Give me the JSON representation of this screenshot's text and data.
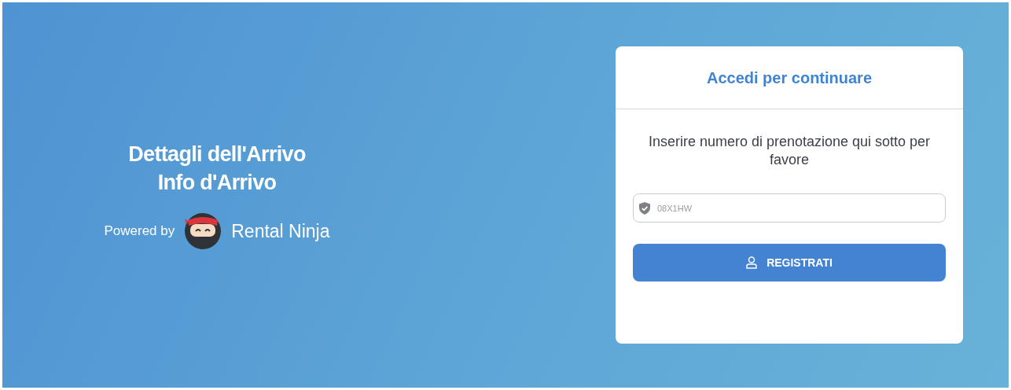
{
  "hero": {
    "title_lines": [
      "Dettagli dell'Arrivo",
      "Info d'Arrivo"
    ],
    "powered_by": "Powered by",
    "brand": "Rental Ninja"
  },
  "card": {
    "title": "Accedi per continuare",
    "instructions": "Inserire numero di prenotazione qui sotto per favore",
    "field": {
      "placeholder": "08X1HW"
    },
    "button": "REGISTRATI"
  }
}
